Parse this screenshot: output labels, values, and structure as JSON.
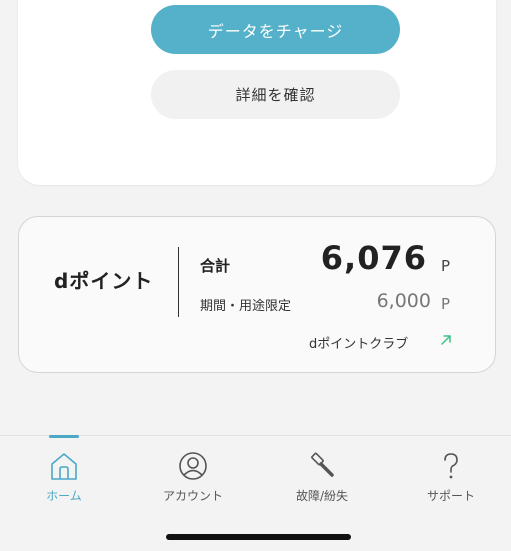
{
  "buttons": {
    "charge_label": "データをチャージ",
    "detail_label": "詳細を確認"
  },
  "dpoint": {
    "title": "dポイント",
    "total_label": "合計",
    "total_value": "6,076",
    "total_unit": "P",
    "limited_label": "期間・用途限定",
    "limited_value": "6,000",
    "limited_unit": "P",
    "club_link_label": "dポイントクラブ",
    "club_link_icon": "external-arrow-icon"
  },
  "tabbar": {
    "active_index": 0,
    "tabs": [
      {
        "label": "ホーム",
        "icon": "home-icon"
      },
      {
        "label": "アカウント",
        "icon": "account-icon"
      },
      {
        "label": "故障/紛失",
        "icon": "hammer-icon"
      },
      {
        "label": "サポート",
        "icon": "question-icon"
      }
    ]
  },
  "colors": {
    "accent": "#4ba8c7",
    "charge_button": "#55b1c9",
    "link_arrow": "#3cc18a",
    "background": "#f3f3f3"
  }
}
